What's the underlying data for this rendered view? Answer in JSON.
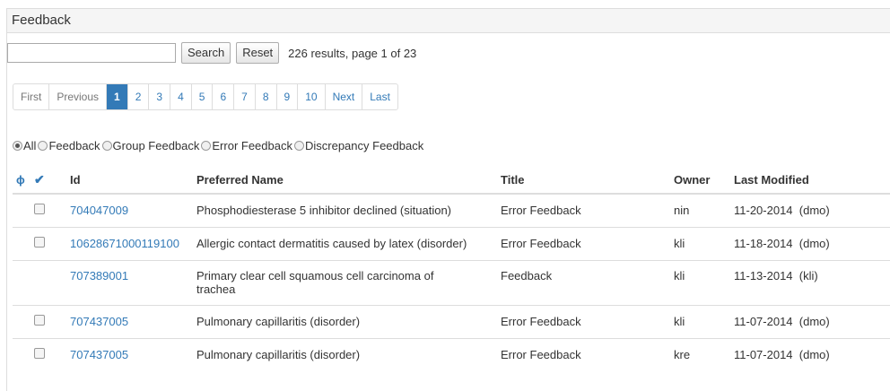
{
  "panel": {
    "title": "Feedback"
  },
  "search": {
    "value": "",
    "placeholder": "",
    "search_label": "Search",
    "reset_label": "Reset",
    "results_text": "226 results, page 1 of 23"
  },
  "pager": {
    "first": "First",
    "previous": "Previous",
    "pages": [
      "1",
      "2",
      "3",
      "4",
      "5",
      "6",
      "7",
      "8",
      "9",
      "10"
    ],
    "next": "Next",
    "last": "Last",
    "active_page": "1"
  },
  "filters": [
    {
      "label": "All",
      "checked": true
    },
    {
      "label": "Feedback",
      "checked": false
    },
    {
      "label": "Group Feedback",
      "checked": false
    },
    {
      "label": "Error Feedback",
      "checked": false
    },
    {
      "label": "Discrepancy Feedback",
      "checked": false
    }
  ],
  "table": {
    "icons": {
      "visibility": "eye-slash-icon",
      "select": "check-icon"
    },
    "headers": {
      "id": "Id",
      "preferred_name": "Preferred Name",
      "title": "Title",
      "owner": "Owner",
      "last_modified": "Last Modified"
    },
    "rows": [
      {
        "checkbox": true,
        "id": "704047009",
        "preferred_name": "Phosphodiesterase 5 inhibitor declined (situation)",
        "title": "Error Feedback",
        "owner": "nin",
        "last_modified": "11-20-2014  (dmo)"
      },
      {
        "checkbox": true,
        "id": "10628671000119100",
        "preferred_name": "Allergic contact dermatitis caused by latex (disorder)",
        "title": "Error Feedback",
        "owner": "kli",
        "last_modified": "11-18-2014  (dmo)"
      },
      {
        "checkbox": false,
        "id": "707389001",
        "preferred_name": "Primary clear cell squamous cell carcinoma of trachea",
        "title": "Feedback",
        "owner": "kli",
        "last_modified": "11-13-2014  (kli)"
      },
      {
        "checkbox": true,
        "id": "707437005",
        "preferred_name": "Pulmonary capillaritis (disorder)",
        "title": "Error Feedback",
        "owner": "kli",
        "last_modified": "11-07-2014  (dmo)"
      },
      {
        "checkbox": true,
        "id": "707437005",
        "preferred_name": "Pulmonary capillaritis (disorder)",
        "title": "Error Feedback",
        "owner": "kre",
        "last_modified": "11-07-2014  (dmo)"
      }
    ]
  }
}
